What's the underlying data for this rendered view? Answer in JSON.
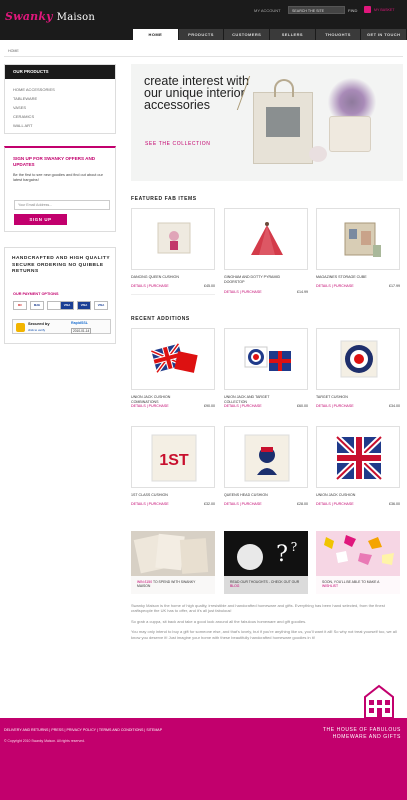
{
  "header": {
    "logo_script": "Swanky",
    "logo_word": "Maison",
    "my_account": "MY ACCOUNT",
    "search_placeholder": "SEARCH THE SITE",
    "find": "FIND",
    "basket": "MY BASKET"
  },
  "nav": [
    "HOME",
    "PRODUCTS",
    "CUSTOMERS",
    "SELLERS",
    "THOUGHTS",
    "GET IN TOUCH"
  ],
  "breadcrumb": "HOME",
  "sidebar": {
    "products_title": "OUR PRODUCTS",
    "categories": [
      "HOME ACCESSORIES",
      "TABLEWARE",
      "VASES",
      "CERAMICS",
      "WALL ART"
    ],
    "signup_title": "SIGN UP FOR SWANKY OFFERS AND UPDATES",
    "signup_text": "Be the first to see new goodies and find out about our latest bargains!",
    "email_placeholder": "Your Email Address...",
    "signup_button": "SIGN UP",
    "trust_text": "HANDCRAFTED AND HIGH QUALITY SECURE ORDERING NO QUIBBLE RETURNS",
    "payment_title": "OUR PAYMENT OPTIONS",
    "cards": [
      "MC",
      "MAE",
      "VISA",
      "VISA",
      "VISA"
    ],
    "secured_by": "Secured by",
    "secured_click": "click to verify",
    "secured_brand": "RapidSSL",
    "secured_date": "2010-01-14"
  },
  "hero": {
    "text": "create interest with our unique interior accessories",
    "link": "SEE THE COLLECTION"
  },
  "featured": {
    "title": "FEATURED FAB ITEMS",
    "items": [
      {
        "name": "DANCING QUEEN CUSHION",
        "links": "DETAILS | PURCHASE",
        "price": "£45.00"
      },
      {
        "name": "GINGHAM AND DOTTY PYRAMID DOORSTOP",
        "links": "DETAILS | PURCHASE",
        "price": "£14.99"
      },
      {
        "name": "MAGAZINES STORAGE CUBE",
        "links": "DETAILS | PURCHASE",
        "price": "£17.99"
      }
    ]
  },
  "recent": {
    "title": "RECENT ADDITIONS",
    "items": [
      {
        "name": "UNION JACK CUSHION COMBINATIONS",
        "links": "DETAILS | PURCHASE",
        "price": "£90.00"
      },
      {
        "name": "UNION JACK AND TARGET COLLECTION",
        "links": "DETAILS | PURCHASE",
        "price": "£60.00"
      },
      {
        "name": "TARGET CUSHION",
        "links": "DETAILS | PURCHASE",
        "price": "£34.00"
      },
      {
        "name": "1ST CLASS CUSHION",
        "links": "DETAILS | PURCHASE",
        "price": "£32.00"
      },
      {
        "name": "QUEENS HEAD CUSHION",
        "links": "DETAILS | PURCHASE",
        "price": "£28.00"
      },
      {
        "name": "UNION JACK CUSHION",
        "links": "DETAILS | PURCHASE",
        "price": "£36.00"
      }
    ]
  },
  "promos": [
    {
      "text_pink": "WIN £150",
      "text_rest": "TO SPEND WITH SWANKY MAISON"
    },
    {
      "text_pink": "",
      "text_rest": "READ OUR THOUGHTS - CHECK OUT OUR ",
      "text_link": "BLOG"
    },
    {
      "text_pink": "",
      "text_rest": "SOON, YOU'LL BE ABLE TO MAKE A ",
      "text_link": "WISHLIST"
    }
  ],
  "about": [
    "Swanky Maison is the home of high quality, irresistible and handcrafted homeware and gifts. Everything has been hand selected, from the finest craftspeople the UK has to offer, and it's all just fabulous!",
    "So grab a cuppa, sit back and take a good look around all the fabulous homeware and gift goodies.",
    "You may only intend to buy a gift for someone else, and that's lovely, but if you're anything like us, you'll want it all! So why not treat yourself too, we all know you deserve it! Just imagine your home with these beautifully handcrafted homeware goodies in it!"
  ],
  "footer": {
    "links": "DELIVERY AND RETURNS  |  PRESS  |  PRIVACY POLICY  |  TERMS AND CONDITIONS  |  SITEMAP",
    "copyright": "© Copyright 2010 Swanky Maison. All rights reserved.",
    "tagline": "THE HOUSE OF FABULOUS HOMEWARE AND GIFTS"
  },
  "colors": {
    "accent": "#c2006d",
    "header": "#1b1b1b"
  }
}
